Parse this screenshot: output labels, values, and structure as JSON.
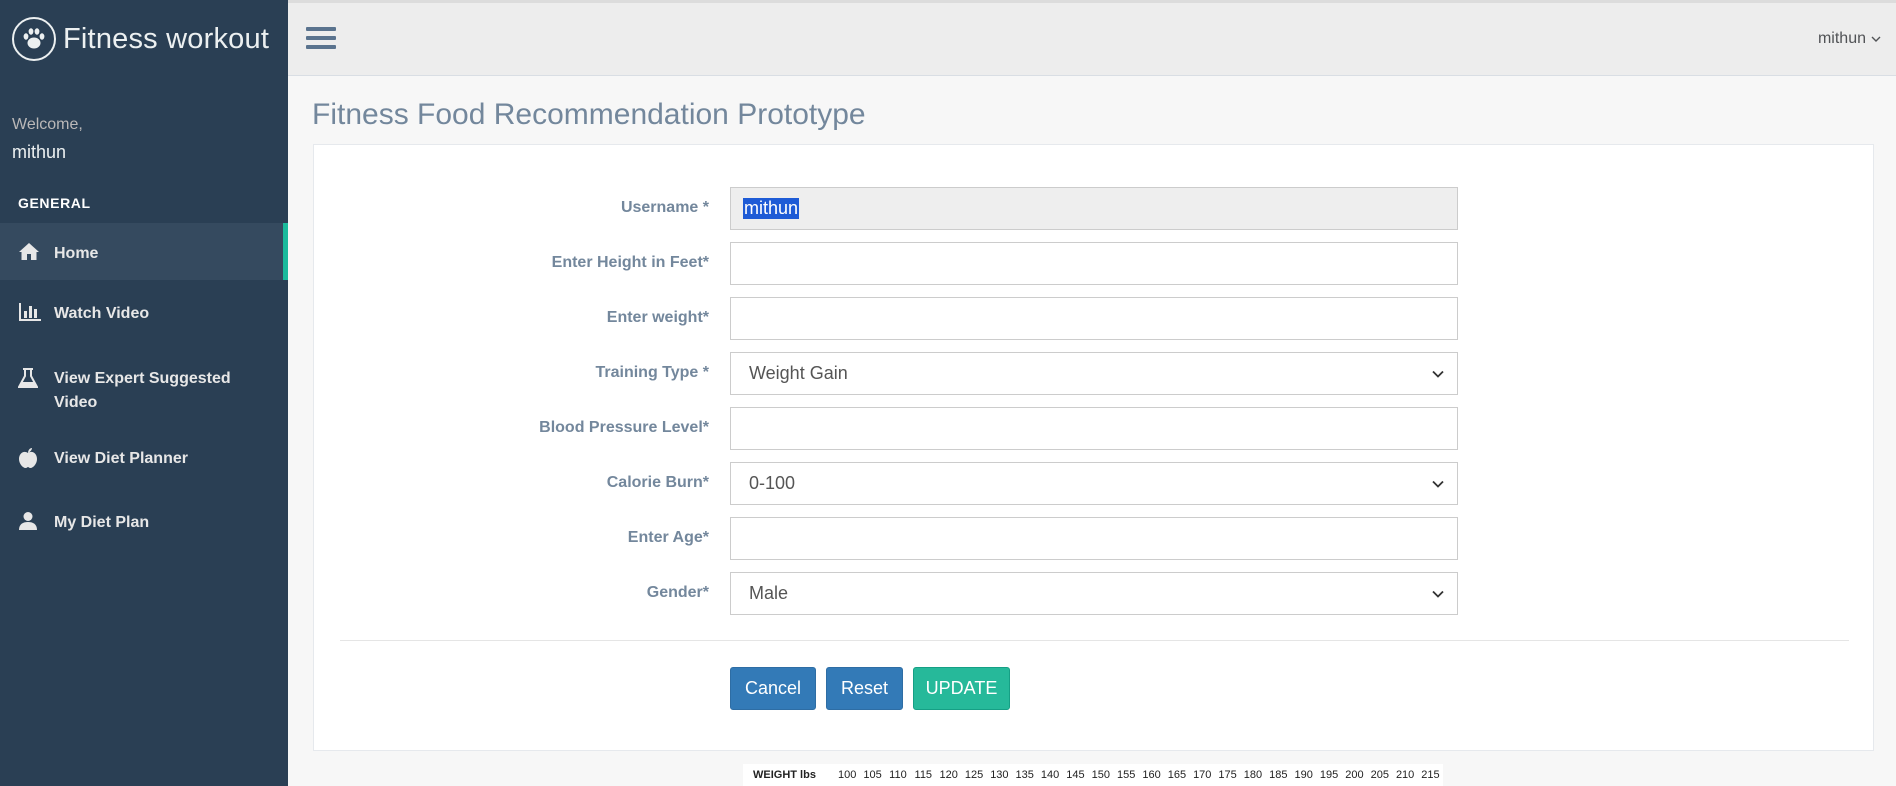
{
  "brand": {
    "title": "Fitness workout",
    "logo_icon": "paw-icon"
  },
  "profile": {
    "welcome": "Welcome,",
    "name": "mithun"
  },
  "sidebar": {
    "section_title": "GENERAL",
    "items": [
      {
        "label": "Home",
        "icon": "home-icon",
        "active": true
      },
      {
        "label": "Watch Video",
        "icon": "bar-chart-icon"
      },
      {
        "label": "View Expert Suggested Video",
        "icon": "flask-icon"
      },
      {
        "label": "View Diet Planner",
        "icon": "apple-icon"
      },
      {
        "label": "My Diet Plan",
        "icon": "user-icon"
      }
    ]
  },
  "topbar": {
    "user": "mithun"
  },
  "page": {
    "title": "Fitness Food Recommendation Prototype"
  },
  "form": {
    "username": {
      "label": "Username *",
      "value": "mithun"
    },
    "height": {
      "label": "Enter Height in Feet*",
      "value": ""
    },
    "weight": {
      "label": "Enter weight*",
      "value": ""
    },
    "training_type": {
      "label": "Training Type *",
      "value": "Weight Gain"
    },
    "blood_pressure": {
      "label": "Blood Pressure Level*",
      "value": ""
    },
    "calorie_burn": {
      "label": "Calorie Burn*",
      "value": "0-100"
    },
    "age": {
      "label": "Enter Age*",
      "value": ""
    },
    "gender": {
      "label": "Gender*",
      "value": "Male"
    },
    "buttons": {
      "cancel": "Cancel",
      "reset": "Reset",
      "update": "UPDATE"
    }
  },
  "weight_strip": {
    "label": "WEIGHT lbs",
    "values": [
      "100",
      "105",
      "110",
      "115",
      "120",
      "125",
      "130",
      "135",
      "140",
      "145",
      "150",
      "155",
      "160",
      "165",
      "170",
      "175",
      "180",
      "185",
      "190",
      "195",
      "200",
      "205",
      "210",
      "215"
    ]
  },
  "colors": {
    "sidebar": "#2a3f54",
    "accent": "#1abb9c",
    "primary_button": "#337ab7",
    "success_button": "#26b99a"
  }
}
